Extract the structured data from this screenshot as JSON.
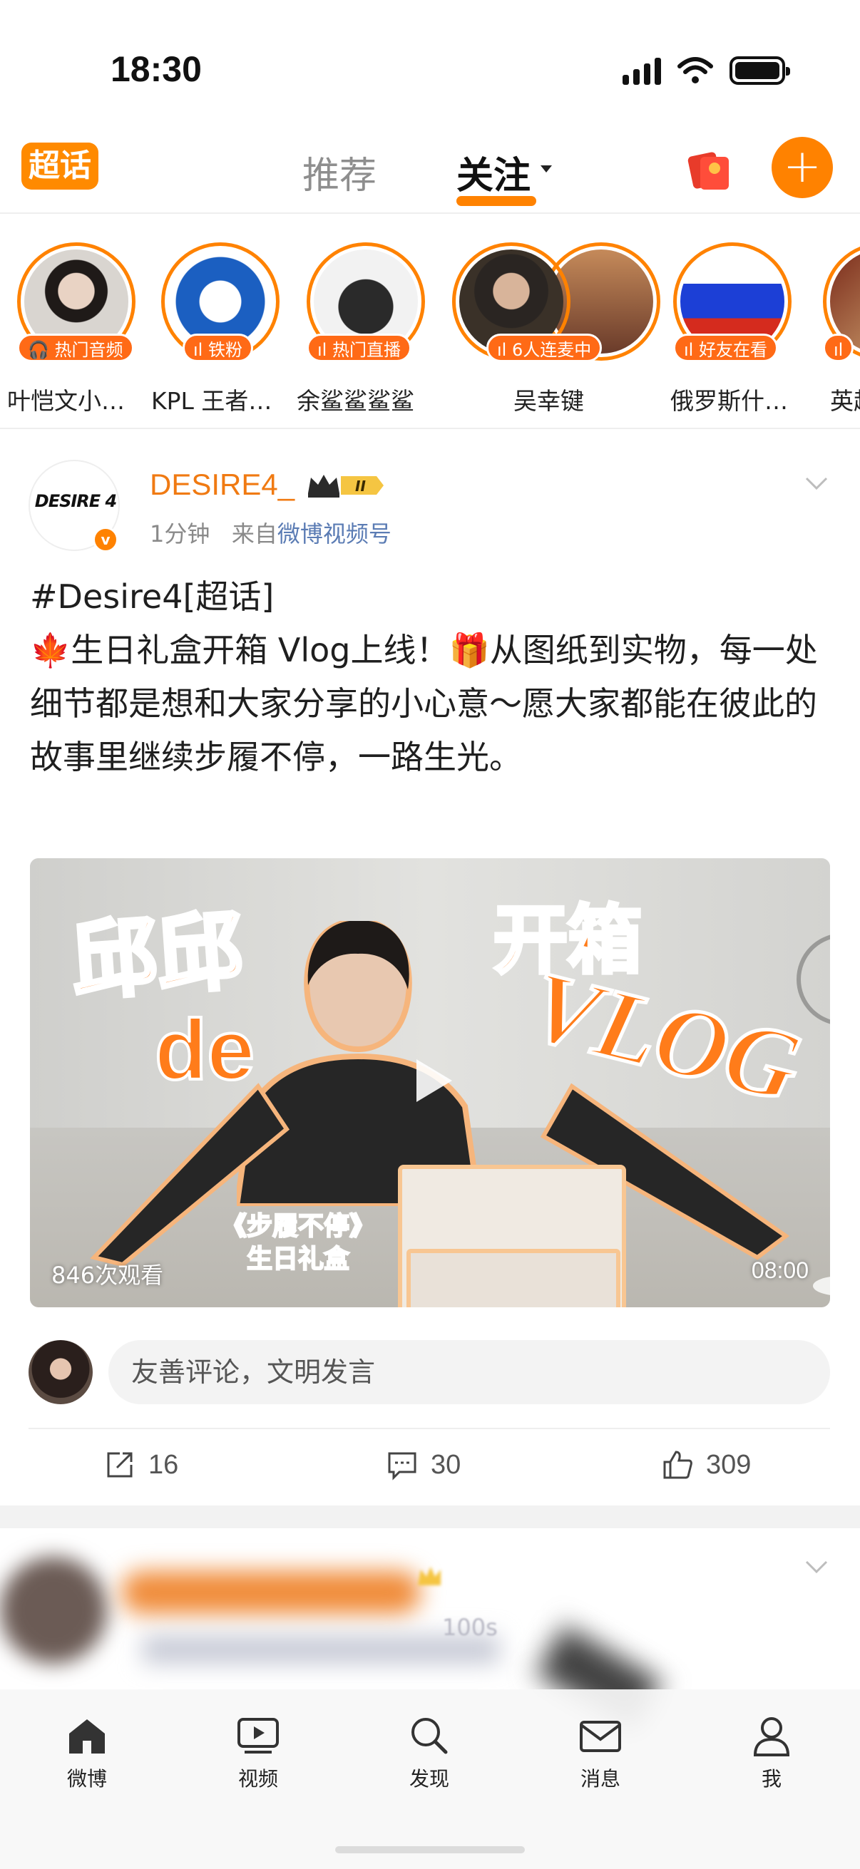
{
  "status_bar": {
    "time": "18:30"
  },
  "header": {
    "logo_label": "超话",
    "tabs": [
      {
        "label": "推荐"
      },
      {
        "label": "关注"
      }
    ],
    "add_label": "+"
  },
  "stories": [
    {
      "name": "叶恺文小…",
      "badge": "热门音频",
      "colors": [
        "#e9e4df",
        "#2a2522"
      ]
    },
    {
      "name": "KPL 王者…",
      "badge": "铁粉",
      "colors": [
        "#1b5fc1",
        "#ffffff"
      ]
    },
    {
      "name": "余鲨鲨鲨鲨",
      "badge": "热门直播",
      "colors": [
        "#f5f5f5",
        "#1e1e1e"
      ]
    },
    {
      "name": "吴幸键",
      "badge": "6人连麦中",
      "colors": [
        "#3a3128",
        "#c58a5a"
      ]
    },
    {
      "name": "俄罗斯什…",
      "badge": "好友在看",
      "colors": [
        "#ffffff",
        "#1c3fd6",
        "#d52b1e"
      ]
    },
    {
      "name": "英超",
      "badge": "",
      "colors": [
        "#7a2a1a",
        "#d8b07a"
      ]
    }
  ],
  "post": {
    "avatar_text": "DESIRE 4",
    "author": "DESIRE4_",
    "crown_level": "II",
    "time": "1分钟",
    "source_prefix": "来自",
    "source": "微博视频号",
    "text_hashtag": "#Desire4[超话]",
    "text_body": "🍁生日礼盒开箱 Vlog上线！🎁从图纸到实物，每一处细节都是想和大家分享的小心意～愿大家都能在彼此的故事里继续步履不停，一路生光。",
    "video": {
      "overlay_title_left": "邱邱",
      "overlay_de": "de",
      "overlay_title_right": "开箱",
      "overlay_vlog": "VLOG",
      "overlay_caption_line1": "《步履不停》",
      "overlay_caption_line2": "生日礼盒",
      "views": "846次观看",
      "duration": "08:00"
    },
    "comment_placeholder": "友善评论，文明发言",
    "actions": {
      "reposts": "16",
      "comments": "30",
      "likes": "309"
    }
  },
  "next_post": {
    "meta": "100s"
  },
  "tabbar": {
    "items": [
      {
        "label": "微博"
      },
      {
        "label": "视频"
      },
      {
        "label": "发现"
      },
      {
        "label": "消息"
      },
      {
        "label": "我"
      }
    ]
  },
  "colors": {
    "accent": "#ff8200",
    "link": "#5b7cb4",
    "author": "#f07a12"
  }
}
